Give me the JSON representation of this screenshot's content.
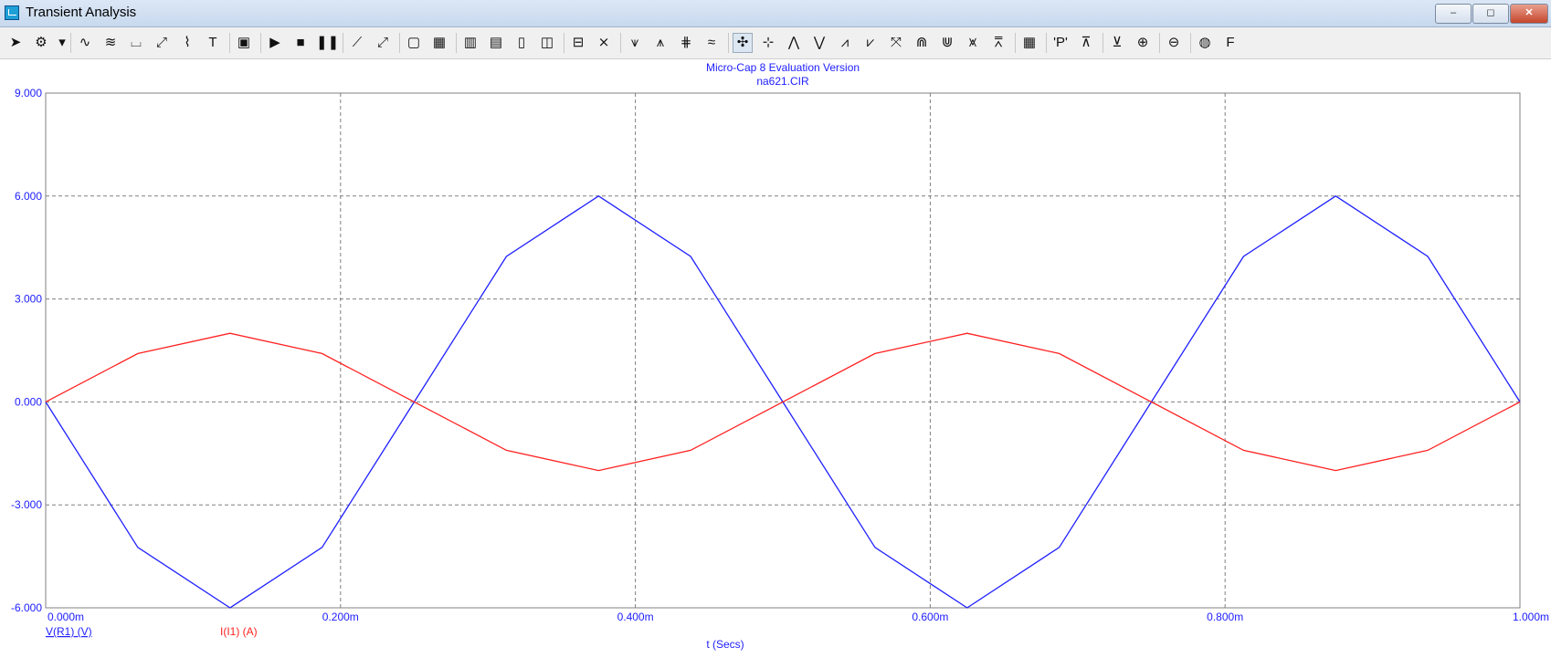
{
  "window": {
    "title": "Transient Analysis",
    "controls": {
      "minimize": "‒",
      "maximize": "◻",
      "close": "✕"
    }
  },
  "toolbar": {
    "tools": [
      {
        "name": "select-arrow-icon",
        "glyph": "➤"
      },
      {
        "name": "component-icon",
        "glyph": "⚙"
      },
      {
        "name": "dropdown-arrow-icon",
        "glyph": "▾"
      },
      {
        "name": "wire-mode-icon",
        "glyph": "∿"
      },
      {
        "name": "add-waveform-icon",
        "glyph": "≋"
      },
      {
        "name": "scope-icon",
        "glyph": "⌴"
      },
      {
        "name": "probe-icon",
        "glyph": "⤢"
      },
      {
        "name": "info-icon",
        "glyph": "⌇"
      },
      {
        "name": "text-icon",
        "glyph": "T"
      },
      {
        "name": "properties-icon",
        "glyph": "▣"
      },
      {
        "name": "run-icon",
        "glyph": "▶"
      },
      {
        "name": "stop-icon",
        "glyph": "■"
      },
      {
        "name": "pause-icon",
        "glyph": "❚❚"
      },
      {
        "name": "line-icon",
        "glyph": "⟋"
      },
      {
        "name": "slope-icon",
        "glyph": "⤢"
      },
      {
        "name": "frame-icon",
        "glyph": "▢"
      },
      {
        "name": "grid-icon",
        "glyph": "▦"
      },
      {
        "name": "vertical-grid-icon",
        "glyph": "▥"
      },
      {
        "name": "horizontal-grid-icon",
        "glyph": "▤"
      },
      {
        "name": "minor-grid-icon",
        "glyph": "▯"
      },
      {
        "name": "split-grid-icon",
        "glyph": "◫"
      },
      {
        "name": "baseline-icon",
        "glyph": "⊟"
      },
      {
        "name": "cursor-intersect-icon",
        "glyph": "⨯"
      },
      {
        "name": "peak-cursor-icon",
        "glyph": "⩛"
      },
      {
        "name": "valley-cursor-icon",
        "glyph": "⩚"
      },
      {
        "name": "high-cursor-icon",
        "glyph": "⋕"
      },
      {
        "name": "low-cursor-icon",
        "glyph": "≈"
      },
      {
        "name": "cursor-mode-icon",
        "glyph": "✣"
      },
      {
        "name": "next-point-icon",
        "glyph": "⊹"
      },
      {
        "name": "peak-icon",
        "glyph": "⋀"
      },
      {
        "name": "valley-icon",
        "glyph": "⋁"
      },
      {
        "name": "high-icon",
        "glyph": "⩘"
      },
      {
        "name": "low-icon",
        "glyph": "⩗"
      },
      {
        "name": "inflection-icon",
        "glyph": "⤧"
      },
      {
        "name": "global-high-icon",
        "glyph": "⋒"
      },
      {
        "name": "global-low-icon",
        "glyph": "⋓"
      },
      {
        "name": "top-icon",
        "glyph": "⩙"
      },
      {
        "name": "bottom-icon",
        "glyph": "⩞"
      },
      {
        "name": "table-icon",
        "glyph": "▦"
      },
      {
        "name": "point-tag-icon",
        "glyph": "'P'"
      },
      {
        "name": "tag-horizontal-icon",
        "glyph": "⊼"
      },
      {
        "name": "tag-vertical-icon",
        "glyph": "⊻"
      },
      {
        "name": "zoom-in-icon",
        "glyph": "⊕"
      },
      {
        "name": "zoom-out-icon",
        "glyph": "⊖"
      },
      {
        "name": "color-icon",
        "glyph": "◍"
      },
      {
        "name": "font-icon",
        "glyph": "F"
      }
    ]
  },
  "plot": {
    "header_line1": "Micro-Cap 8 Evaluation Version",
    "header_line2": "na621.CIR",
    "colors": {
      "voltage": "#2020ff",
      "current": "#ff2020",
      "axis_text": "#2020ff",
      "grid": "#808080"
    }
  },
  "chart_data": {
    "type": "line",
    "title": "Micro-Cap 8 Evaluation Version",
    "subtitle": "na621.CIR",
    "xlabel": "t (Secs)",
    "xlim": [
      0,
      0.001
    ],
    "ylim": [
      -6,
      9
    ],
    "x_tick_labels": [
      "0.000m",
      "0.200m",
      "0.400m",
      "0.600m",
      "0.800m",
      "1.000m"
    ],
    "y_tick_labels": [
      "9.000",
      "6.000",
      "3.000",
      "0.000",
      "-3.000",
      "-6.000"
    ],
    "grid": true,
    "series": [
      {
        "name": "V(R1) (V)",
        "color": "#2020ff",
        "x": [
          0,
          6.25e-05,
          0.000125,
          0.0001875,
          0.00025,
          0.0003125,
          0.000375,
          0.0004375,
          0.0005,
          0.0005625,
          0.000625,
          0.0006875,
          0.00075,
          0.0008125,
          0.000875,
          0.0009375,
          0.001
        ],
        "y": [
          0,
          -4.24,
          -6,
          -4.24,
          0,
          4.24,
          6,
          4.24,
          0,
          -4.24,
          -6,
          -4.24,
          0,
          4.24,
          6,
          4.24,
          0
        ]
      },
      {
        "name": "I(I1) (A)",
        "color": "#ff2020",
        "x": [
          0,
          6.25e-05,
          0.000125,
          0.0001875,
          0.00025,
          0.0003125,
          0.000375,
          0.0004375,
          0.0005,
          0.0005625,
          0.000625,
          0.0006875,
          0.00075,
          0.0008125,
          0.000875,
          0.0009375,
          0.001
        ],
        "y": [
          0,
          1.41,
          2,
          1.41,
          0,
          -1.41,
          -2,
          -1.41,
          0,
          1.41,
          2,
          1.41,
          0,
          -1.41,
          -2,
          -1.41,
          0
        ]
      }
    ]
  }
}
